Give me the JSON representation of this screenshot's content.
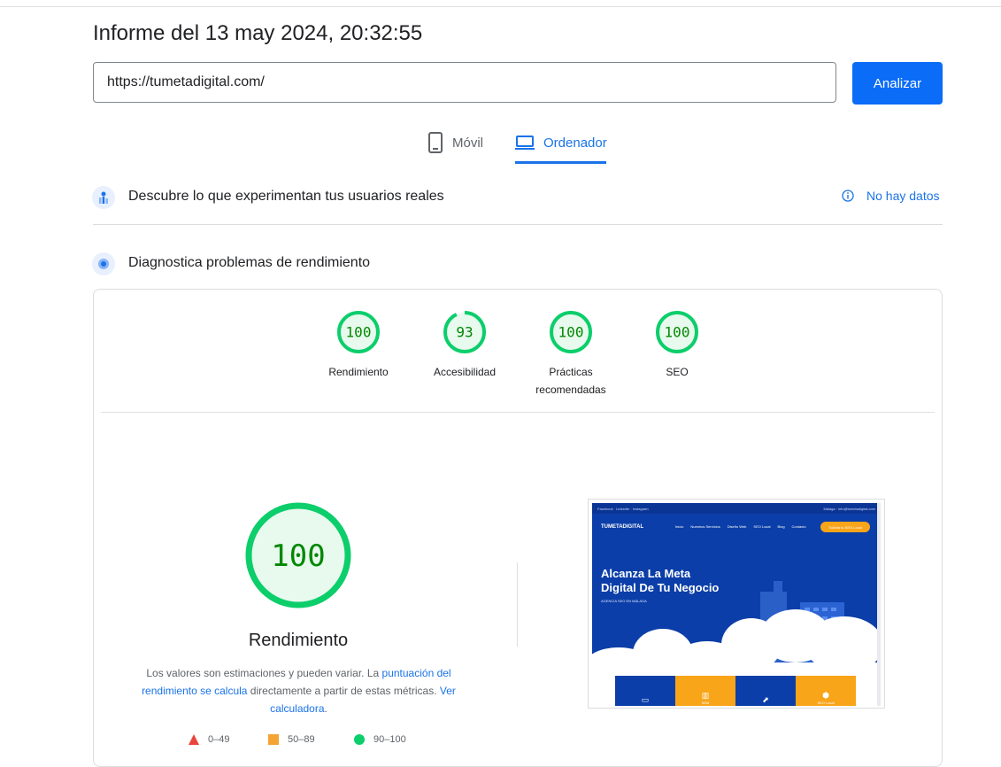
{
  "report": {
    "title": "Informe del 13 may 2024, 20:32:55"
  },
  "search": {
    "url": "https://tumetadigital.com/",
    "analyze_label": "Analizar"
  },
  "tabs": [
    {
      "label": "Móvil",
      "icon": "smartphone-icon",
      "active": false
    },
    {
      "label": "Ordenador",
      "icon": "laptop-icon",
      "active": true
    }
  ],
  "field_data": {
    "title": "Descubre lo que experimentan tus usuarios reales",
    "status_label": "No hay datos",
    "icon": "field-data-icon"
  },
  "lab_data": {
    "title": "Diagnostica problemas de rendimiento",
    "icon": "lab-data-icon"
  },
  "scores": [
    {
      "label": "Rendimiento",
      "score": "100",
      "value": 100
    },
    {
      "label": "Accesibilidad",
      "score": "93",
      "value": 93
    },
    {
      "label": "Prácticas recomendadas",
      "label_line1": "Prácticas",
      "label_line2": "recomendadas",
      "score": "100",
      "value": 100
    },
    {
      "label": "SEO",
      "score": "100",
      "value": 100
    }
  ],
  "performance": {
    "score": "100",
    "value": 100,
    "title": "Rendimiento",
    "explain_prefix": "Los valores son estimaciones y pueden variar. La ",
    "explain_link1": "puntuación del rendimiento se calcula",
    "explain_middle": " directamente a partir de estas métricas. ",
    "explain_link2": "Ver calculadora",
    "explain_suffix": "."
  },
  "legend": [
    {
      "range": "0–49",
      "shape": "triangle",
      "color": "#e8453c"
    },
    {
      "range": "50–89",
      "shape": "square",
      "color": "#f4a433"
    },
    {
      "range": "90–100",
      "shape": "circle",
      "color": "#0cce6b"
    }
  ],
  "colors": {
    "pass": "#0cce6b",
    "pass_fill": "#e8f9ee",
    "pass_text": "#008800",
    "accent": "#1a73e8"
  },
  "screenshot": {
    "topbar_left": "Facebook · LinkedIn · Instagram",
    "topbar_right": "Málaga · info@tumetadigital.com",
    "logo": "TUMETADIGITAL",
    "menu": [
      "Inicio",
      "Nuestros Servicios",
      "Diseño Web",
      "SEO Local",
      "Blog",
      "Contacto"
    ],
    "cta": "Solicita tu SEO Local",
    "headline_line1": "Alcanza La Meta",
    "headline_line2": "Digital De Tu Negocio",
    "subline": "AGENCIA SEO EN MÁLAGA",
    "cards": [
      {
        "label": "",
        "icon": "monitor-icon",
        "color": "#0b3ea8"
      },
      {
        "label": "SEM",
        "icon": "chart-icon",
        "color": "#f9a51a"
      },
      {
        "label": "",
        "icon": "growth-icon",
        "color": "#0b3ea8"
      },
      {
        "label": "SEO Local",
        "icon": "pin-icon",
        "color": "#f9a51a"
      }
    ]
  }
}
